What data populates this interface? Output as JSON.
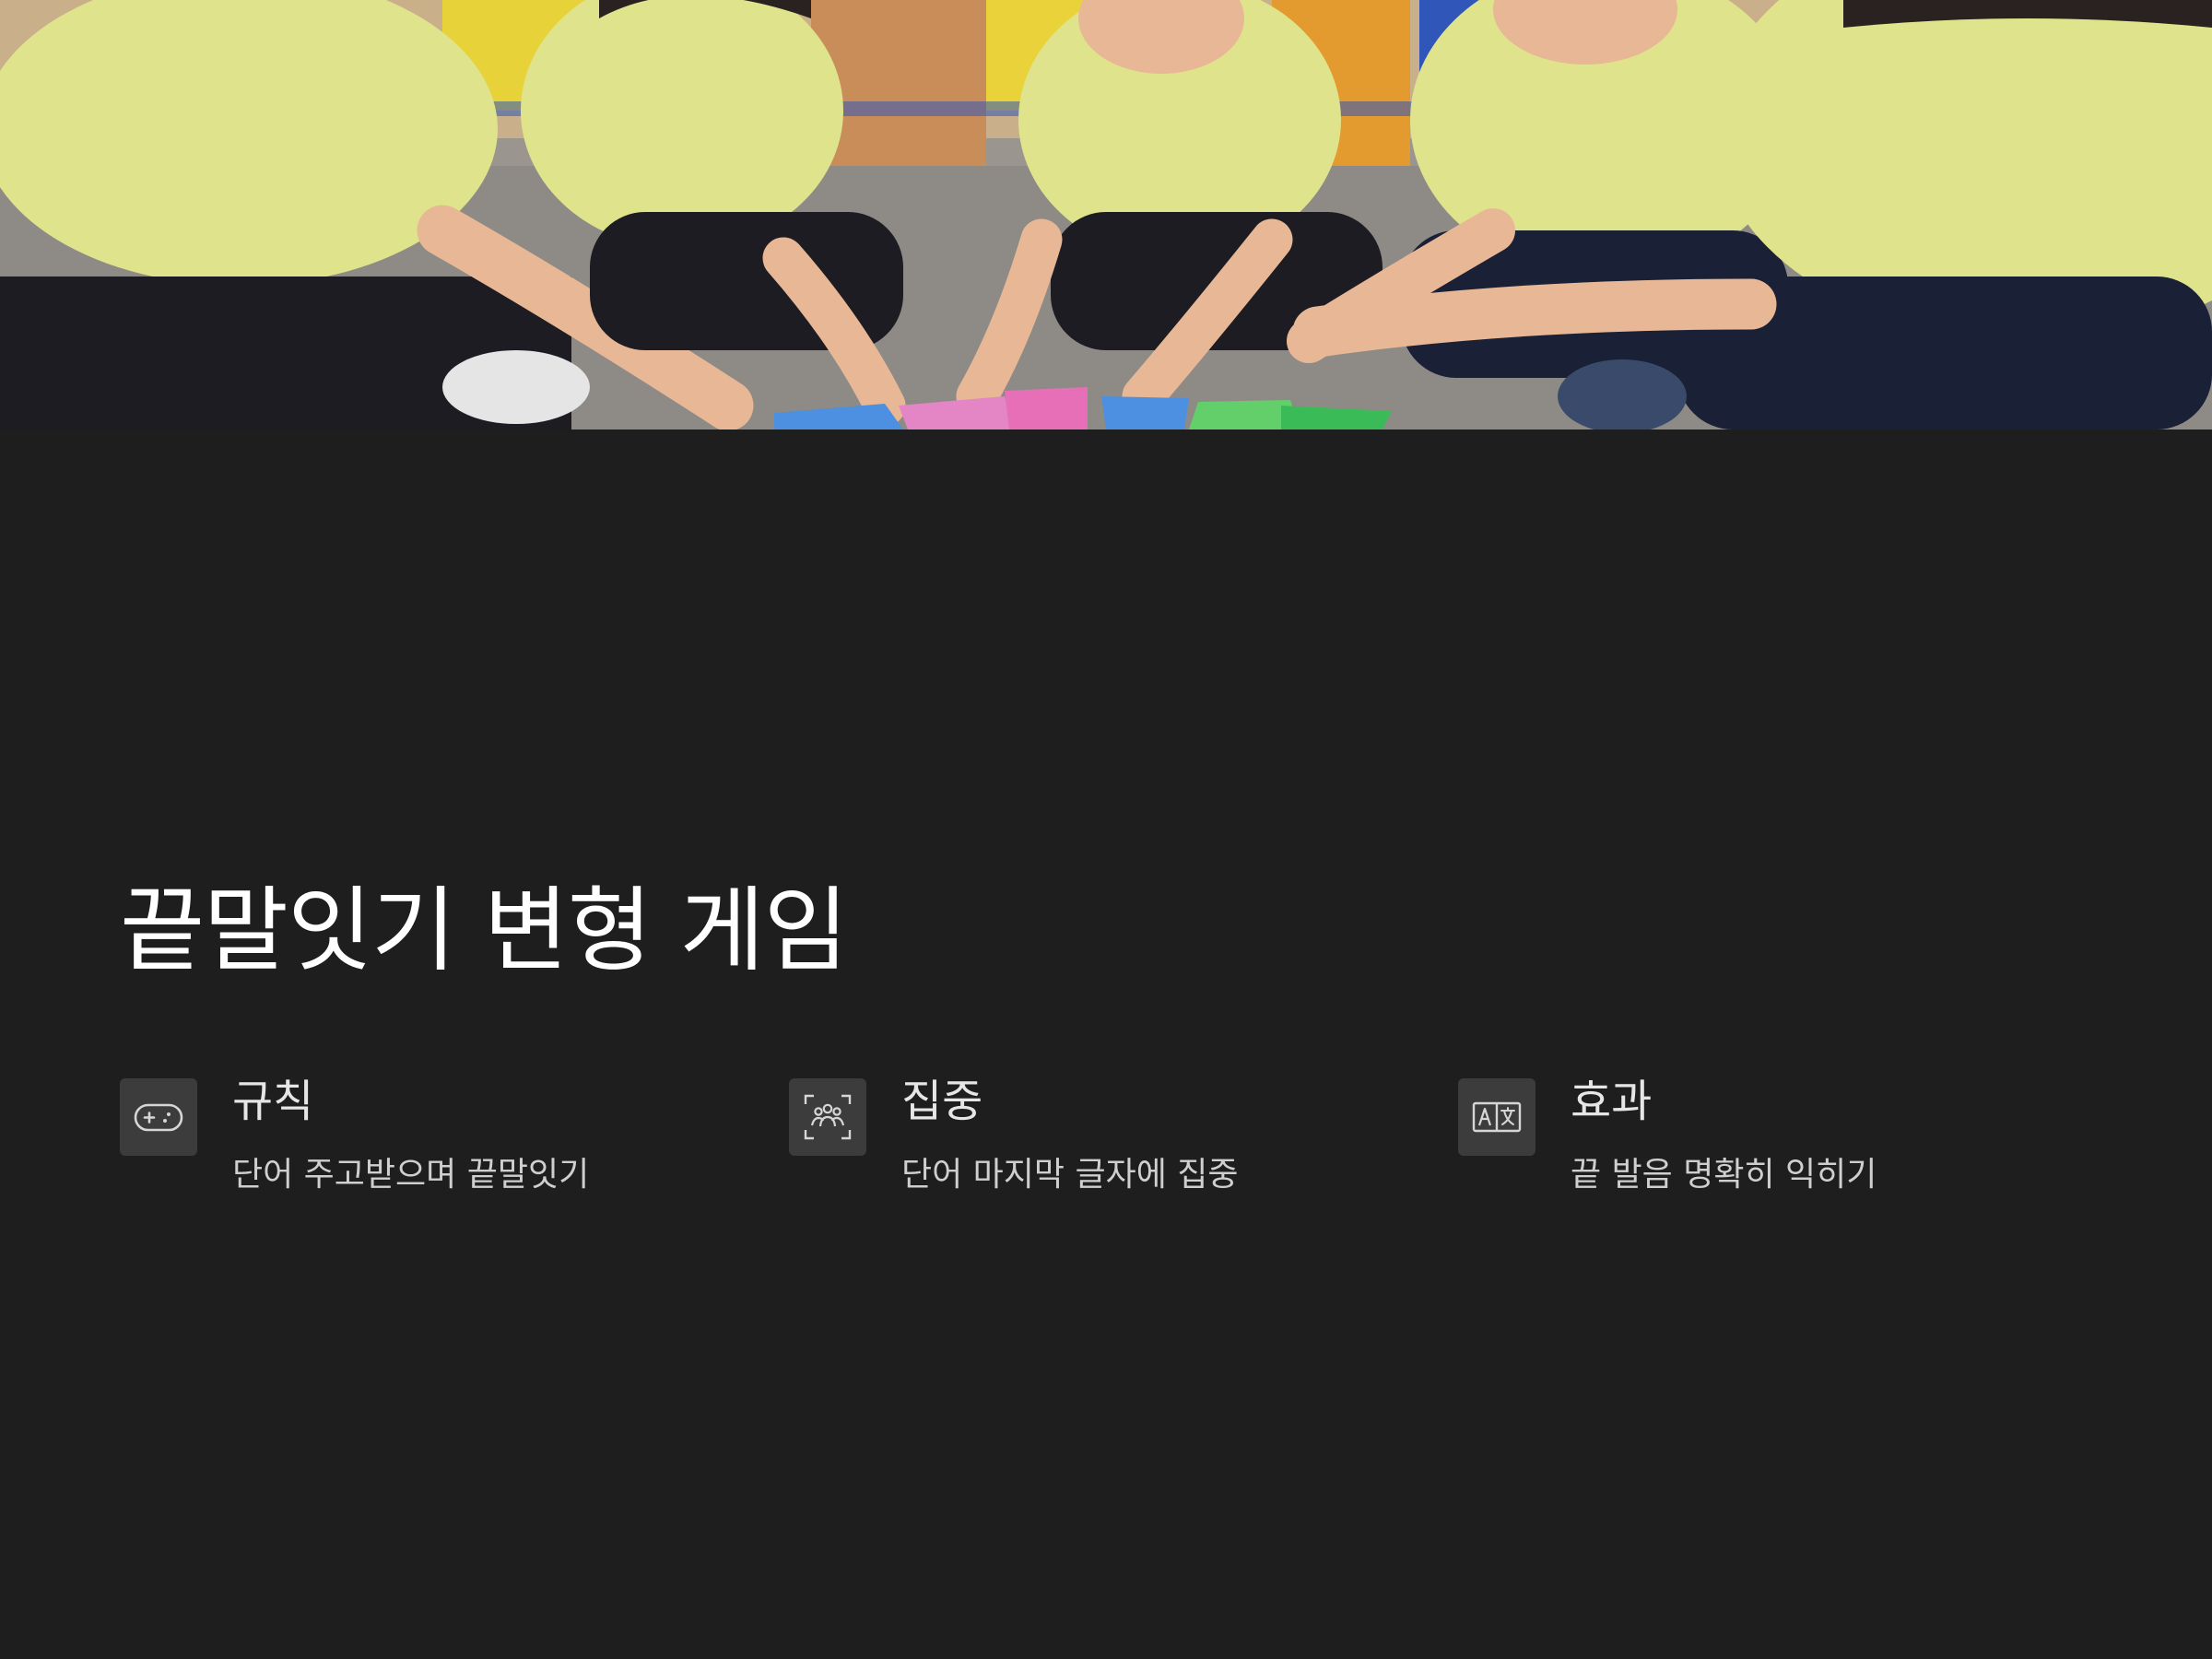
{
  "hero_image": {
    "description_icon": "children-playing-word-cards-photo"
  },
  "title": "끝말잇기 변형 게임",
  "features": [
    {
      "icon": "gamepad-icon",
      "title": "규칙",
      "desc": "단어 주고받으며 끝말잇기"
    },
    {
      "icon": "group-focus-icon",
      "title": "집중",
      "desc": "단어 마지막 글자에 집중"
    },
    {
      "icon": "translate-icon",
      "title": "효과",
      "desc": "끝 발음 명확히 익히기"
    }
  ],
  "colors": {
    "background": "#1e1e1e",
    "title": "#ffffff",
    "text": "#cfcfcf",
    "icon_box": "#3c3c3c"
  }
}
